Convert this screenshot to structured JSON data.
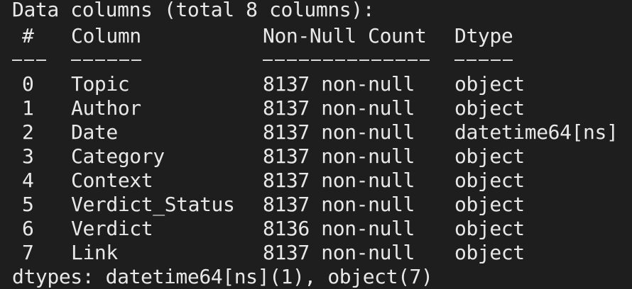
{
  "header_line": "Data columns (total 8 columns):",
  "table": {
    "headers": {
      "index": "#",
      "column": "Column",
      "count": "Non-Null Count",
      "dtype": "Dtype"
    },
    "rows": [
      {
        "index": "0",
        "column": "Topic",
        "count": "8137 non-null",
        "dtype": "object"
      },
      {
        "index": "1",
        "column": "Author",
        "count": "8137 non-null",
        "dtype": "object"
      },
      {
        "index": "2",
        "column": "Date",
        "count": "8137 non-null",
        "dtype": "datetime64[ns]"
      },
      {
        "index": "3",
        "column": "Category",
        "count": "8137 non-null",
        "dtype": "object"
      },
      {
        "index": "4",
        "column": "Context",
        "count": "8137 non-null",
        "dtype": "object"
      },
      {
        "index": "5",
        "column": "Verdict_Status",
        "count": "8137 non-null",
        "dtype": "object"
      },
      {
        "index": "6",
        "column": "Verdict",
        "count": "8136 non-null",
        "dtype": "object"
      },
      {
        "index": "7",
        "column": "Link",
        "count": "8137 non-null",
        "dtype": "object"
      }
    ]
  },
  "footer_line": "dtypes: datetime64[ns](1), object(7)",
  "colors": {
    "background": "#1e1e1e",
    "text": "#e8e8e8"
  }
}
